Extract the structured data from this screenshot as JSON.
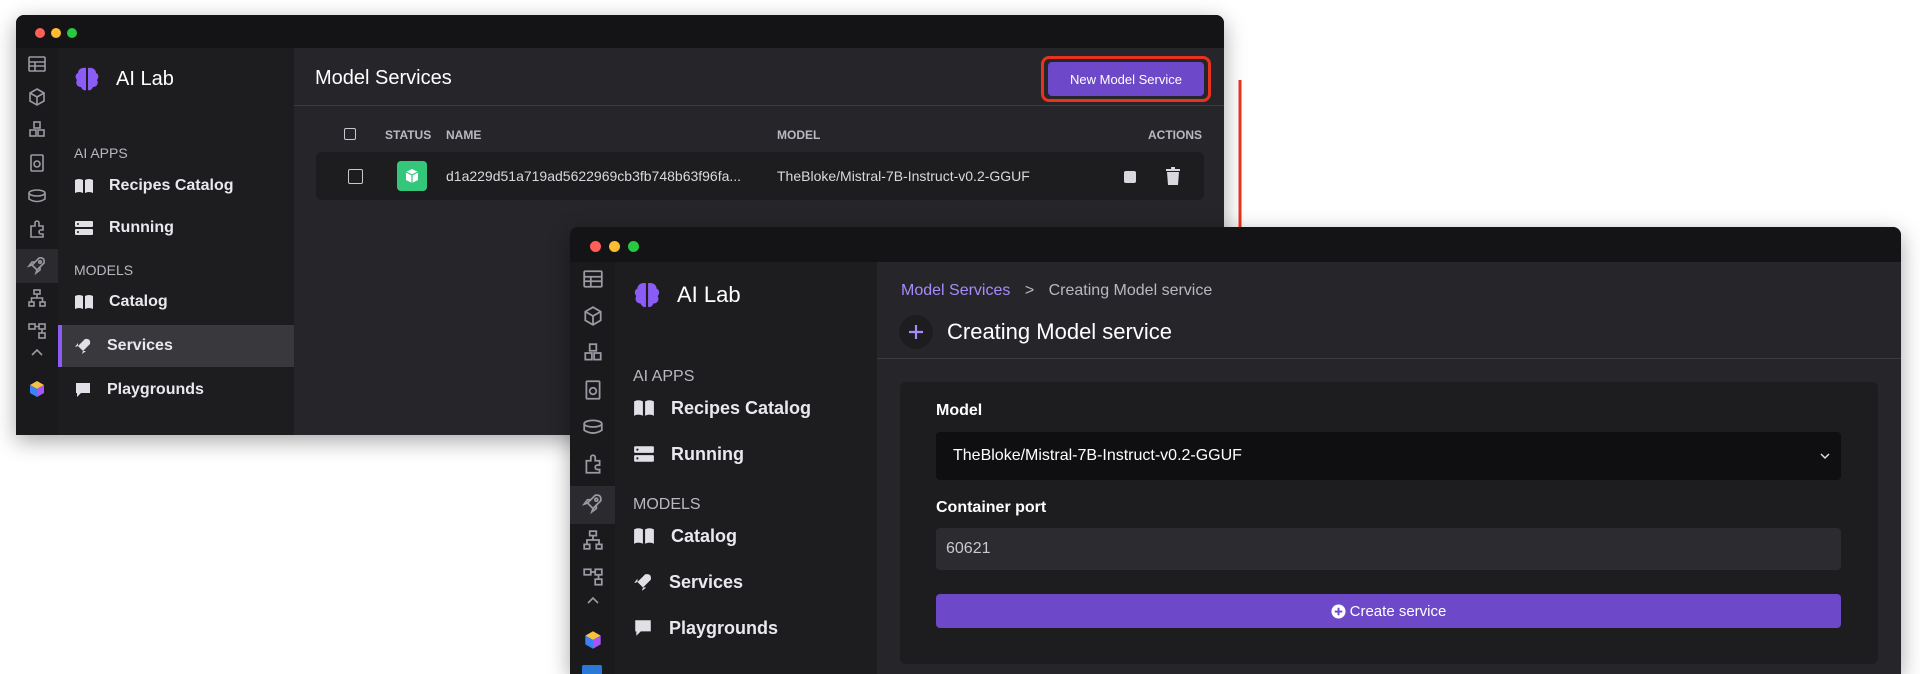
{
  "app": {
    "brand": "AI Lab"
  },
  "sidebar": {
    "section_apps": "AI APPS",
    "section_models": "MODELS",
    "items": [
      {
        "label": "Recipes Catalog",
        "icon": "book-icon"
      },
      {
        "label": "Running",
        "icon": "server-icon"
      },
      {
        "label": "Catalog",
        "icon": "book-icon"
      },
      {
        "label": "Services",
        "icon": "rocket-icon"
      },
      {
        "label": "Playgrounds",
        "icon": "chat-icon"
      }
    ]
  },
  "services_page": {
    "title": "Model Services",
    "new_button": "New Model Service",
    "columns": {
      "status": "STATUS",
      "name": "NAME",
      "model": "MODEL",
      "actions": "ACTIONS"
    },
    "row": {
      "name": "d1a229d51a719ad5622969cb3fb748b63f96fa...",
      "model": "TheBloke/Mistral-7B-Instruct-v0.2-GGUF"
    }
  },
  "create_page": {
    "breadcrumb_link": "Model Services",
    "breadcrumb_sep": ">",
    "breadcrumb_current": "Creating Model service",
    "title": "Creating Model service",
    "model_label": "Model",
    "model_value": "TheBloke/Mistral-7B-Instruct-v0.2-GGUF",
    "port_label": "Container port",
    "port_value": "60621",
    "create_button": "Create service"
  },
  "colors": {
    "accent": "#6d48c8",
    "highlight": "#e8321e",
    "link": "#a78bfa"
  }
}
